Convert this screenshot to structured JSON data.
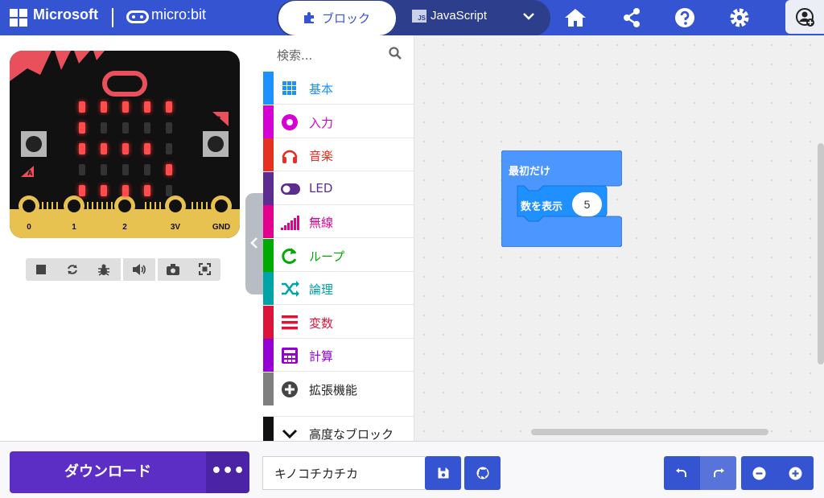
{
  "header": {
    "brand": "Microsoft",
    "product": "micro:bit",
    "tabs": [
      {
        "label": "ブロック",
        "active": true
      },
      {
        "label": "JavaScript",
        "active": false
      }
    ],
    "icons": [
      "home-icon",
      "share-icon",
      "help-icon",
      "settings-icon",
      "user-icon"
    ],
    "accent": "#3454d1"
  },
  "simulator": {
    "pins": [
      "0",
      "1",
      "2",
      "3V",
      "GND"
    ],
    "button_a": "A",
    "button_b": "B",
    "led_matrix": [
      [
        1,
        1,
        1,
        1,
        1
      ],
      [
        1,
        0,
        0,
        0,
        0
      ],
      [
        1,
        1,
        1,
        1,
        0
      ],
      [
        0,
        0,
        0,
        0,
        1
      ],
      [
        1,
        1,
        1,
        1,
        0
      ]
    ],
    "controls": [
      "stop-icon",
      "restart-icon",
      "debug-icon",
      "sound-icon",
      "screenshot-icon",
      "fullscreen-icon"
    ]
  },
  "toolbox": {
    "search_placeholder": "検索...",
    "categories": [
      {
        "label": "基本",
        "color": "#1e90ff",
        "icon": "grid-icon"
      },
      {
        "label": "入力",
        "color": "#d400d4",
        "icon": "input-circle-icon"
      },
      {
        "label": "音楽",
        "color": "#e63022",
        "icon": "headphones-icon"
      },
      {
        "label": "LED",
        "color": "#5c2d91",
        "icon": "toggle-icon"
      },
      {
        "label": "無線",
        "color": "#e3008c",
        "icon": "signal-bars-icon"
      },
      {
        "label": "ループ",
        "color": "#00aa00",
        "icon": "loop-arrow-icon"
      },
      {
        "label": "論理",
        "color": "#00a4a6",
        "icon": "shuffle-icon"
      },
      {
        "label": "変数",
        "color": "#dc143c",
        "icon": "lines-icon"
      },
      {
        "label": "計算",
        "color": "#9400d3",
        "icon": "calculator-icon"
      },
      {
        "label": "拡張機能",
        "color": "#7f7f7f",
        "icon": "plus-circle-icon"
      },
      {
        "label": "高度なブロック",
        "color": "#111111",
        "icon": "chevron-down-icon"
      }
    ]
  },
  "workspace": {
    "on_start_label": "最初だけ",
    "show_number_label": "数を表示",
    "show_number_value": "5",
    "block_color": "#4c97ff"
  },
  "footer": {
    "download_label": "ダウンロード",
    "more_label": "•••",
    "project_name": "キノコチカチカ",
    "download_color": "#5c2ec6"
  }
}
